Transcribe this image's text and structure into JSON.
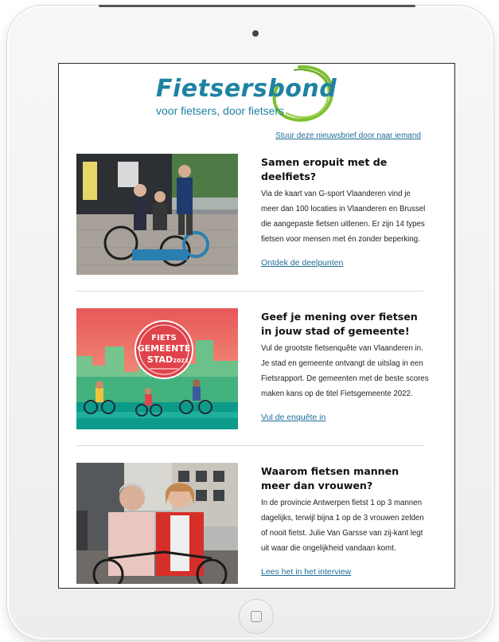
{
  "header": {
    "logo_title": "Fietsersbond",
    "logo_tagline": "voor fietsers, door fietsers",
    "forward_link": "Stuur deze nieuwsbrief door naar iemand"
  },
  "articles": [
    {
      "title": "Samen eropuit met de deelfiets?",
      "body": "Via de kaart van G-sport Vlaanderen vind je meer dan 100 locaties in Vlaanderen en Brussel die aangepaste fietsen uitlenen. Er zijn 14 types fietsen voor mensen met én zonder beperking.",
      "cta": "Ontdek de deelpunten"
    },
    {
      "title": "Geef je mening over fietsen in jouw stad of gemeente!",
      "body": "Vul de grootste fietsenquête van Vlaanderen in. Je stad en gemeente ontvangt de uitslag in een Fietsrapport. De gemeenten met de beste scores maken kans op de titel Fietsgemeente 2022.",
      "cta": "Vul de enquête in",
      "badge": {
        "line1": "FIETS",
        "line2": "GEMEENTE",
        "line3": "STAD",
        "year": "2022"
      }
    },
    {
      "title": "Waarom fietsen mannen meer dan vrouwen?",
      "body": "In de provincie Antwerpen fietst 1 op 3 mannen dagelijks, terwijl bijna 1 op de 3 vrouwen zelden of nooit fietst. Julie Van Garsse van zij-kant legt uit waar die ongelijkheid vandaan komt.",
      "cta": "Lees het in het interview"
    }
  ],
  "colors": {
    "brand_blue": "#1f82a3",
    "brand_green": "#7dbf2f",
    "link": "#1f6d96",
    "badge_red": "#e0434b"
  }
}
